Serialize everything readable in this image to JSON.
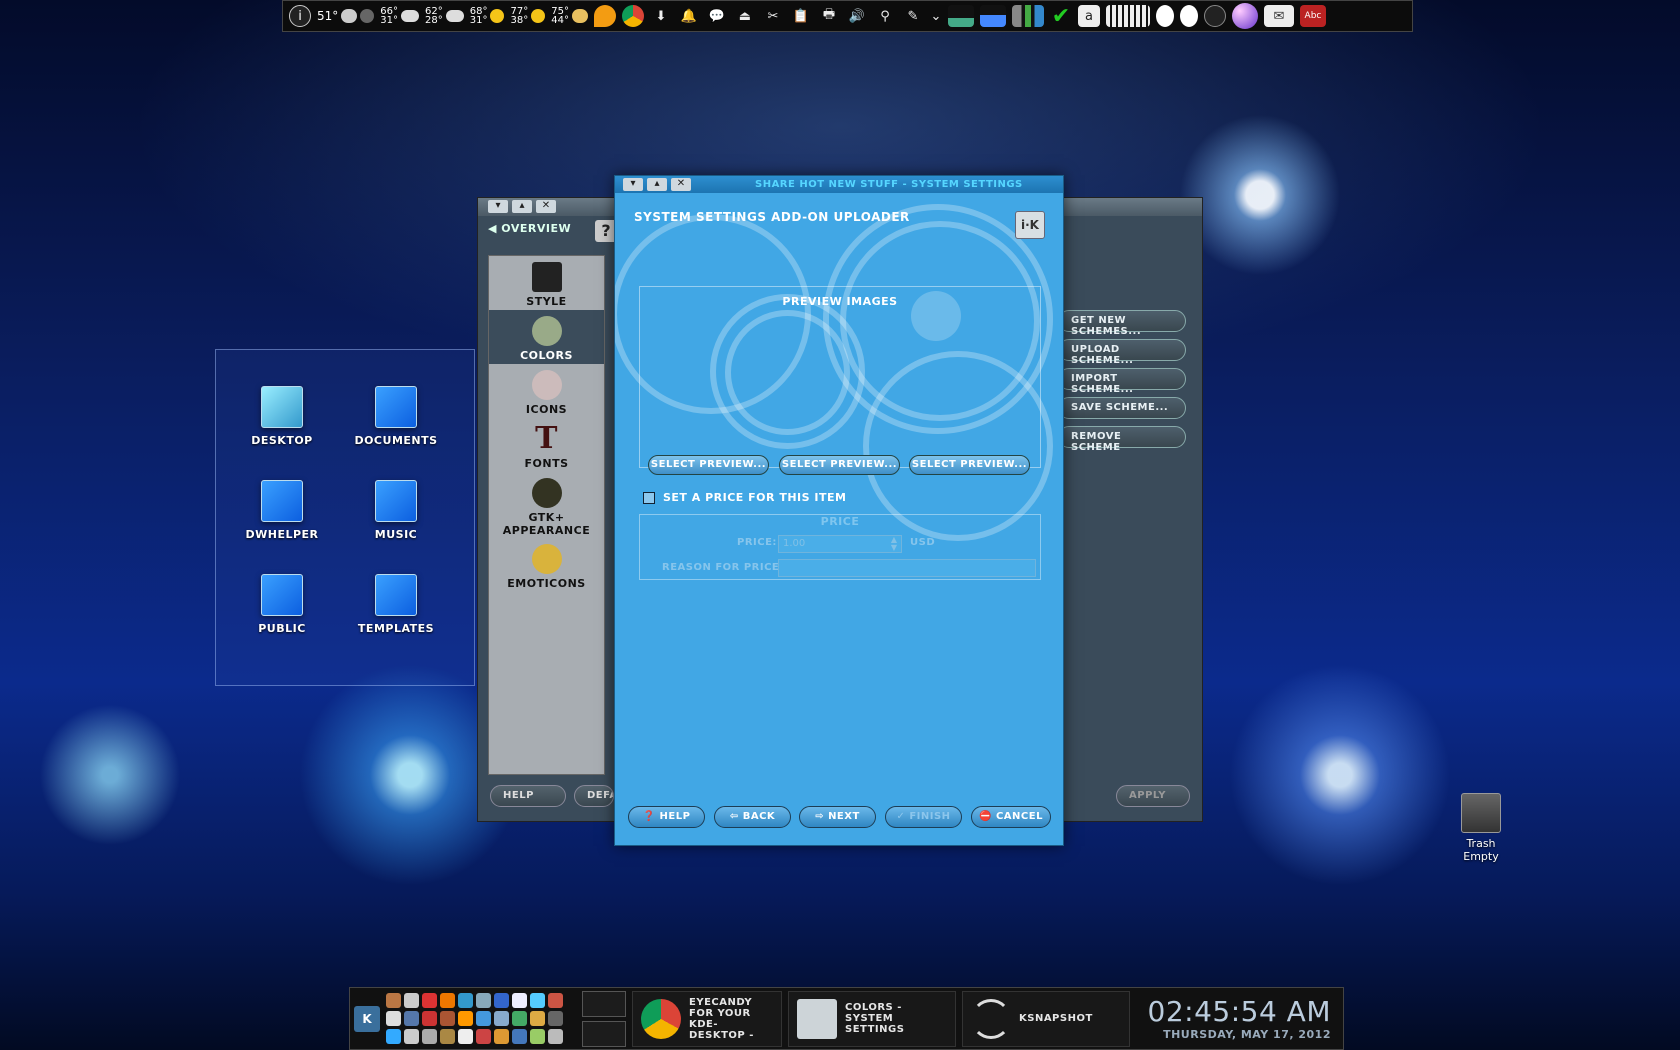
{
  "top_panel": {
    "weather": [
      {
        "temp": "51°",
        "hi": "",
        "lo": ""
      },
      {
        "temp": "",
        "hi": "66°",
        "lo": "31°"
      },
      {
        "temp": "",
        "hi": "62°",
        "lo": "28°"
      },
      {
        "temp": "",
        "hi": "68°",
        "lo": "31°"
      },
      {
        "temp": "",
        "hi": "77°",
        "lo": "38°"
      },
      {
        "temp": "",
        "hi": "75°",
        "lo": "44°"
      }
    ],
    "mail_icon": "mail-icon",
    "spellcheck_label": "Abc"
  },
  "folder_view": {
    "icons": [
      {
        "label": "Desktop"
      },
      {
        "label": "Documents"
      },
      {
        "label": "DWHelper"
      },
      {
        "label": "Music"
      },
      {
        "label": "Public"
      },
      {
        "label": "Templates"
      }
    ]
  },
  "settings_window": {
    "overview": "Overview",
    "side_items": [
      "Style",
      "Colors",
      "Icons",
      "Fonts",
      "GTK+ Appearance",
      "Emoticons"
    ],
    "right_buttons": [
      "Get New Schemes...",
      "Upload Scheme...",
      "Import Scheme...",
      "Save Scheme...",
      "Remove Scheme"
    ],
    "help": "Help",
    "default": "Default",
    "apply": "Apply"
  },
  "uploader": {
    "window_title": "Share Hot New Stuff - System Settings",
    "heading": "System Settings Add-On Uploader",
    "preview_label": "Preview Images",
    "select_preview": [
      "Select Preview...",
      "Select Preview...",
      "Select Preview..."
    ],
    "price_checkbox": "Set a price for this item",
    "price_group": "Price",
    "price_label": "Price:",
    "price_value": "1.00",
    "currency": "USD",
    "reason_label": "Reason for price:",
    "buttons": {
      "help": "Help",
      "back": "Back",
      "next": "Next",
      "finish": "Finish",
      "cancel": "Cancel"
    }
  },
  "trash": {
    "title": "Trash",
    "status": "Empty"
  },
  "taskbar": {
    "tasks": [
      {
        "label": "Eyecandy for your KDE-Desktop - KDE-Look.org - Google"
      },
      {
        "label": "Colors - System Settings"
      },
      {
        "label": "KSnapshot"
      }
    ],
    "clock_time": "02:45:54 AM",
    "clock_date": "Thursday, May 17, 2012"
  }
}
